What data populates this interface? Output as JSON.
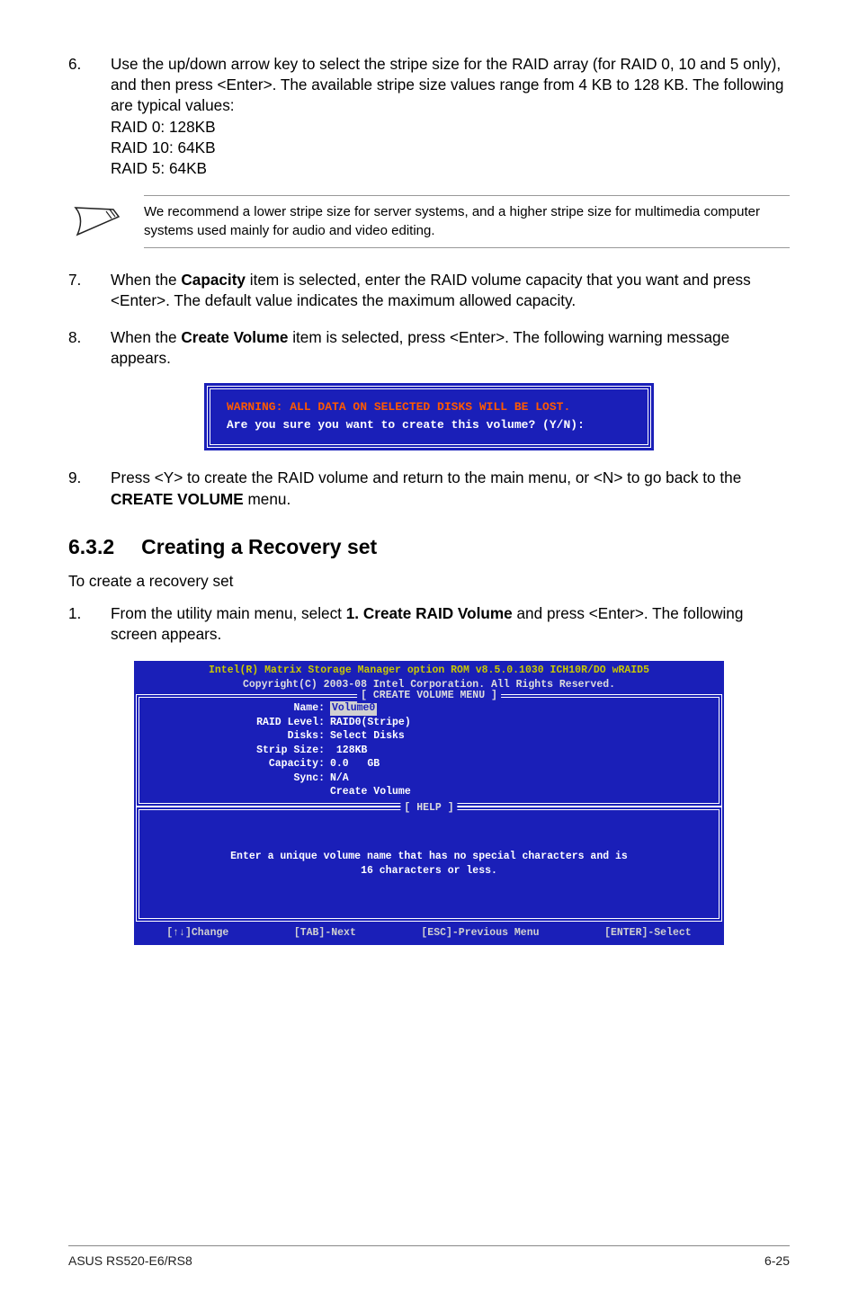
{
  "step6": {
    "num": "6.",
    "text": "Use the up/down arrow key to select the stripe size for the RAID array (for RAID 0, 10 and 5 only), and then press <Enter>. The available stripe size values range from 4 KB to 128 KB. The following are typical values:",
    "l1": "RAID 0: 128KB",
    "l2": "RAID 10: 64KB",
    "l3": "RAID 5: 64KB"
  },
  "note": "We recommend a lower stripe size for server systems, and a higher stripe size for multimedia computer systems used mainly for audio and video editing.",
  "step7": {
    "num": "7.",
    "before": "When the ",
    "bold": "Capacity",
    "after": " item is selected, enter the RAID volume capacity that you want and press <Enter>. The default value indicates the maximum allowed capacity."
  },
  "step8": {
    "num": "8.",
    "before": "When the ",
    "bold": "Create Volume",
    "after": " item is selected, press <Enter>. The following warning message appears."
  },
  "warn": {
    "line1": "WARNING: ALL DATA ON SELECTED DISKS WILL BE LOST.",
    "line2": "Are you sure you want to create this volume? (Y/N):"
  },
  "step9": {
    "num": "9.",
    "before": "Press <Y> to create the RAID volume and return to the main menu, or <N> to go back to the ",
    "bold": "CREATE VOLUME",
    "after": " menu."
  },
  "section": {
    "num": "6.3.2",
    "title": "Creating a Recovery set"
  },
  "intro": "To create a recovery set",
  "step1": {
    "num": "1.",
    "before": "From the utility main menu, select ",
    "bold": "1. Create RAID Volume",
    "after": " and press <Enter>. The following screen appears."
  },
  "bios": {
    "h1": "Intel(R) Matrix Storage Manager option ROM v8.5.0.1030 ICH10R/DO wRAID5",
    "h2": "Copyright(C) 2003-08 Intel Corporation.  All Rights Reserved.",
    "box1_title": "[ CREATE VOLUME MENU ]",
    "fields": {
      "name_label": "Name:",
      "name_val": "Volume0",
      "raid_label": "RAID Level:",
      "raid_val": "RAID0(Stripe)",
      "disks_label": "Disks:",
      "disks_val": "Select Disks",
      "strip_label": "Strip Size:",
      "strip_val": " 128KB",
      "cap_label": "Capacity:",
      "cap_val": "0.0   GB",
      "sync_label": "Sync:",
      "sync_val": "N/A",
      "create": "Create Volume"
    },
    "box2_title": "[ HELP ]",
    "help1": "Enter a unique volume name that has no special characters and is",
    "help2": "16 characters or less.",
    "foot": {
      "a": "[↑↓]Change",
      "b": "[TAB]-Next",
      "c": "[ESC]-Previous Menu",
      "d": "[ENTER]-Select"
    }
  },
  "footer": {
    "left": "ASUS RS520-E6/RS8",
    "right": "6-25"
  }
}
